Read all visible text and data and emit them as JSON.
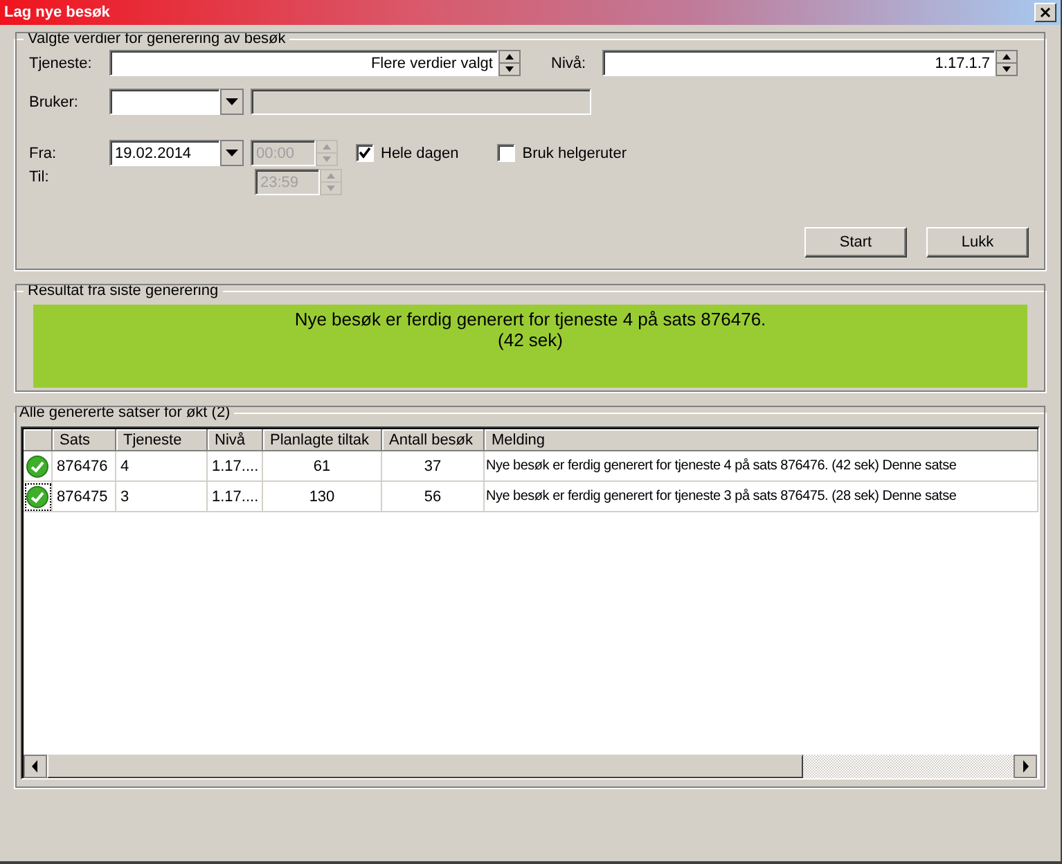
{
  "window": {
    "title": "Lag nye besøk"
  },
  "selection": {
    "title": "Valgte verdier for generering av besøk",
    "service": {
      "label": "Tjeneste:",
      "value": "Flere verdier valgt"
    },
    "level_field": {
      "label": "Nivå:",
      "value": "1.17.1.7"
    },
    "user": {
      "label": "Bruker:"
    },
    "from": {
      "label": "Fra:",
      "date": "19.02.2014",
      "time": "00:00",
      "time_disabled": true
    },
    "to": {
      "label": "Til:",
      "time": "23:59",
      "time_disabled": true
    },
    "checkboxes": [
      {
        "label": "Hele dagen",
        "checked": true
      },
      {
        "label": "Bruk helgeruter",
        "checked": false
      }
    ],
    "buttons": [
      "Start",
      "Lukk"
    ]
  },
  "result": {
    "title": "Resultat fra siste generering",
    "color": "#99cc33",
    "lines": [
      "Nye besøk er ferdig generert for tjeneste 4 på sats 876476.",
      "(42 sek)"
    ]
  },
  "batches": {
    "title": "Alle genererte satser for økt (2)",
    "columns": [
      "Sats",
      "Tjeneste",
      "Nivå",
      "Planlagte tiltak",
      "Antall besøk",
      "Melding"
    ],
    "rows": [
      {
        "kind": "ok",
        "focused": false,
        "cells": [
          "876476",
          "4",
          "1.17....",
          "61",
          "37",
          "Nye besøk er ferdig generert for tjeneste 4 på sats 876476. (42 sek) Denne satse"
        ]
      },
      {
        "kind": "ok",
        "focused": true,
        "cells": [
          "876475",
          "3",
          "1.17....",
          "130",
          "56",
          "Nye besøk er ferdig generert for tjeneste 3 på sats 876475. (28 sek) Denne satse"
        ]
      }
    ]
  }
}
